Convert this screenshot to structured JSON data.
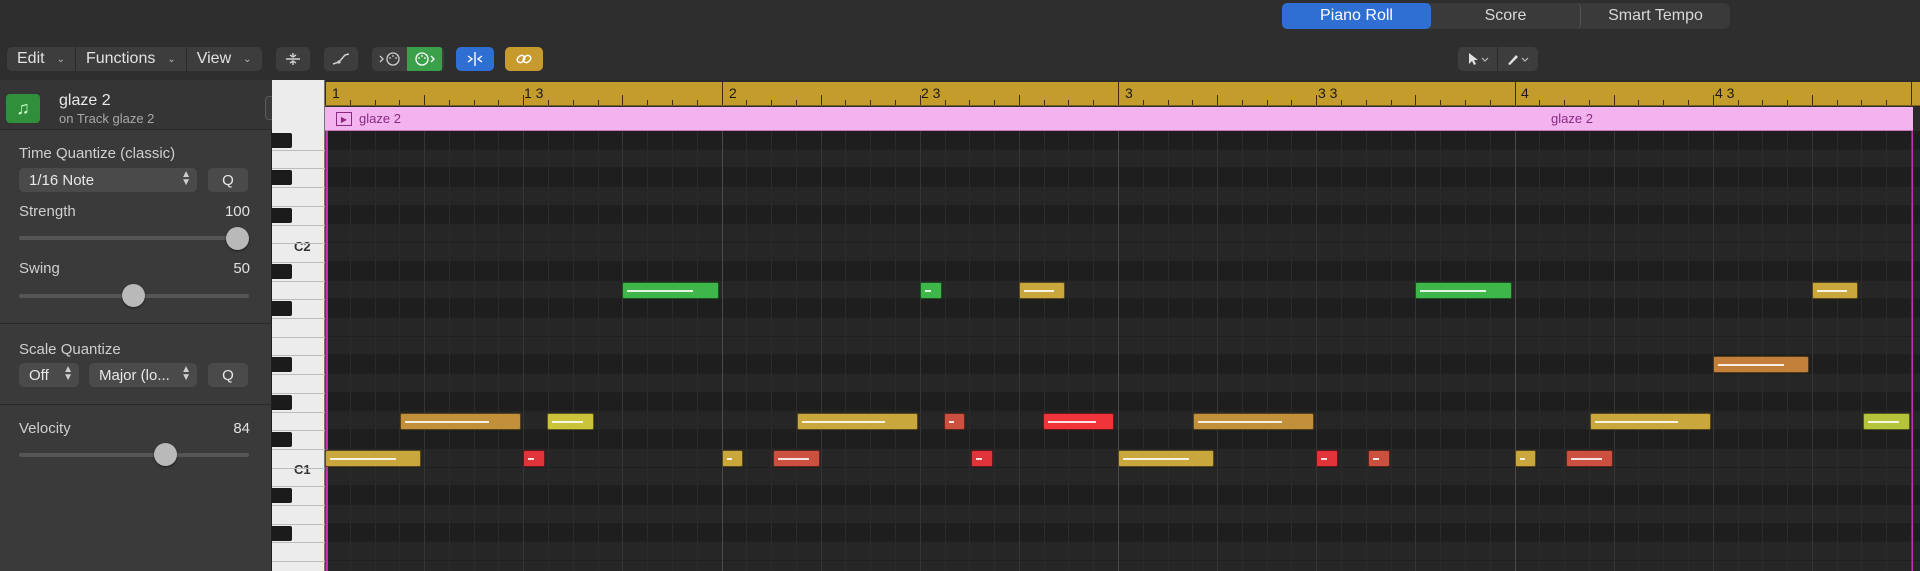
{
  "tabs": {
    "piano_roll": "Piano Roll",
    "score": "Score",
    "smart_tempo": "Smart Tempo"
  },
  "toolbar": {
    "edit": "Edit",
    "functions": "Functions",
    "view": "View"
  },
  "track": {
    "name": "glaze 2",
    "subtitle": "on Track glaze 2"
  },
  "time_quantize": {
    "label": "Time Quantize (classic)",
    "value": "1/16 Note",
    "q_label": "Q",
    "strength_label": "Strength",
    "strength_value": "100",
    "swing_label": "Swing",
    "swing_value": "50"
  },
  "scale_quantize": {
    "label": "Scale Quantize",
    "mode": "Off",
    "scale": "Major (lo...",
    "q_label": "Q"
  },
  "velocity": {
    "label": "Velocity",
    "value": "84"
  },
  "keyboard": {
    "c2": "C2",
    "c1": "C1"
  },
  "ruler": {
    "m1": "1",
    "m1_3": "1 3",
    "m2": "2",
    "m2_3": "2 3",
    "m3": "3",
    "m3_3": "3 3",
    "m4": "4",
    "m4_3": "4 3"
  },
  "region": {
    "name_left": "glaze 2",
    "name_right": "glaze 2"
  },
  "colors": {
    "accent_blue": "#2f6fd4",
    "ruler_gold": "#c49c2c",
    "region_pink": "#f3b3ee",
    "playhead": "#c52fb4",
    "track_green": "#2f8f3b"
  },
  "icons": [
    "music-note-icon",
    "catch-icon",
    "collapse-icon",
    "automation-icon",
    "midi-in-icon",
    "midi-out-icon",
    "snap-icon",
    "link-icon",
    "pointer-tool-icon",
    "pencil-tool-icon",
    "region-loop-icon"
  ],
  "notes": [
    {
      "bar": 1.0,
      "len_beats": 1.0,
      "row": 17,
      "color": "#c9a73c"
    },
    {
      "bar": 1.19,
      "len_beats": 1.25,
      "row": 15,
      "color": "#c2903a"
    },
    {
      "bar": 1.5,
      "len_beats": 0.25,
      "row": 17,
      "color": "#e0333a"
    },
    {
      "bar": 1.56,
      "len_beats": 0.5,
      "row": 15,
      "color": "#cbc43a"
    },
    {
      "bar": 1.75,
      "len_beats": 1.0,
      "row": 8,
      "color": "#3fb64a"
    },
    {
      "bar": 2.0,
      "len_beats": 0.25,
      "row": 17,
      "color": "#c9a73c"
    },
    {
      "bar": 2.13,
      "len_beats": 0.5,
      "row": 17,
      "color": "#cc5040"
    },
    {
      "bar": 2.19,
      "len_beats": 1.25,
      "row": 15,
      "color": "#c9a73c"
    },
    {
      "bar": 2.5,
      "len_beats": 0.25,
      "row": 8,
      "color": "#3fb64a"
    },
    {
      "bar": 2.56,
      "len_beats": 0.25,
      "row": 15,
      "color": "#cc5040"
    },
    {
      "bar": 2.63,
      "len_beats": 0.25,
      "row": 17,
      "color": "#e0333a"
    },
    {
      "bar": 2.75,
      "len_beats": 0.5,
      "row": 8,
      "color": "#c9a73c"
    },
    {
      "bar": 2.81,
      "len_beats": 0.75,
      "row": 15,
      "color": "#f0343a"
    },
    {
      "bar": 3.0,
      "len_beats": 1.0,
      "row": 17,
      "color": "#c9a73c"
    },
    {
      "bar": 3.19,
      "len_beats": 1.25,
      "row": 15,
      "color": "#c2903a"
    },
    {
      "bar": 3.5,
      "len_beats": 0.25,
      "row": 17,
      "color": "#e0333a"
    },
    {
      "bar": 3.63,
      "len_beats": 0.25,
      "row": 17,
      "color": "#cc5040"
    },
    {
      "bar": 3.75,
      "len_beats": 1.0,
      "row": 8,
      "color": "#3fb64a"
    },
    {
      "bar": 4.0,
      "len_beats": 0.25,
      "row": 17,
      "color": "#c9a73c"
    },
    {
      "bar": 4.13,
      "len_beats": 0.5,
      "row": 17,
      "color": "#cc5040"
    },
    {
      "bar": 4.19,
      "len_beats": 1.25,
      "row": 15,
      "color": "#c9a73c"
    },
    {
      "bar": 4.5,
      "len_beats": 1.0,
      "row": 12,
      "color": "#c2803a"
    },
    {
      "bar": 4.75,
      "len_beats": 0.5,
      "row": 8,
      "color": "#c9a73c"
    },
    {
      "bar": 4.88,
      "len_beats": 0.5,
      "row": 15,
      "color": "#b5c43a"
    }
  ]
}
